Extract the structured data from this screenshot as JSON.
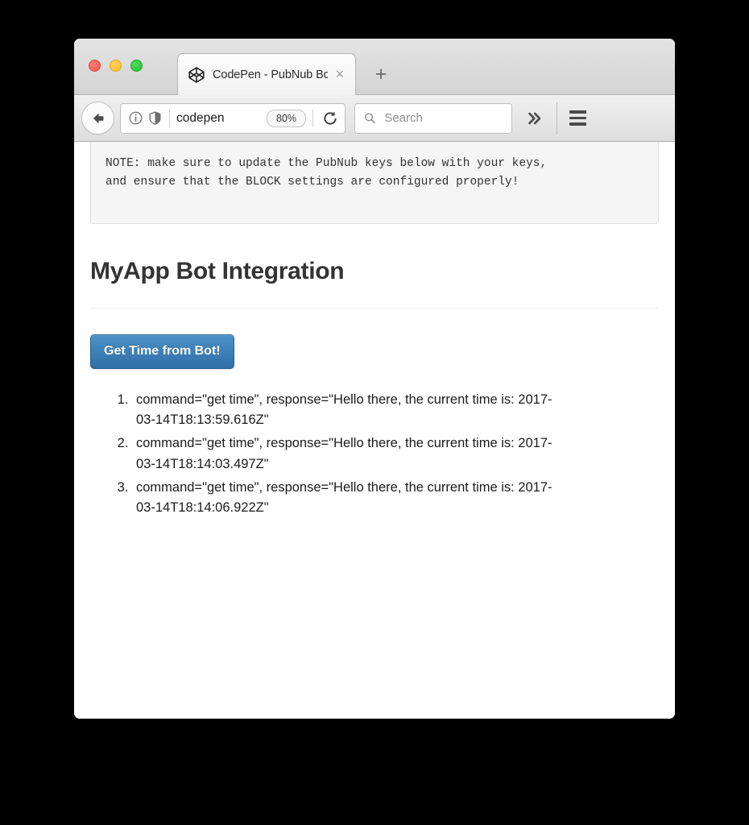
{
  "window": {
    "traffic_lights": [
      {
        "name": "close",
        "color": "#f9574c"
      },
      {
        "name": "minimize",
        "color": "#fbbc2b"
      },
      {
        "name": "zoom",
        "color": "#1fc22e"
      }
    ]
  },
  "tabstrip": {
    "tab": {
      "favicon": "codepen-logo-icon",
      "title": "CodePen - PubNub Bot Inte...",
      "close_label": "×"
    },
    "new_tab_label": "+"
  },
  "toolbar": {
    "back_icon": "back-arrow-icon",
    "identity_icon": "info-circle-icon",
    "tracking_icon": "shield-icon",
    "url_value": "codepen",
    "zoom_level": "80%",
    "reload_icon": "reload-icon",
    "search_icon": "search-icon",
    "search_value": "",
    "search_placeholder": "Search",
    "overflow_label": "»",
    "menu_icon": "hamburger-menu-icon"
  },
  "page": {
    "note_text": "NOTE: make sure to update the PubNub keys below with your keys,\nand ensure that the BLOCK settings are configured properly!",
    "title": "MyApp Bot Integration",
    "button_label": "Get Time from Bot!",
    "button_color": "#2f6ea6",
    "results": [
      "command=\"get time\", response=\"Hello there, the current time is: 2017-03-14T18:13:59.616Z\"",
      "command=\"get time\", response=\"Hello there, the current time is: 2017-03-14T18:14:03.497Z\"",
      "command=\"get time\", response=\"Hello there, the current time is: 2017-03-14T18:14:06.922Z\""
    ]
  }
}
